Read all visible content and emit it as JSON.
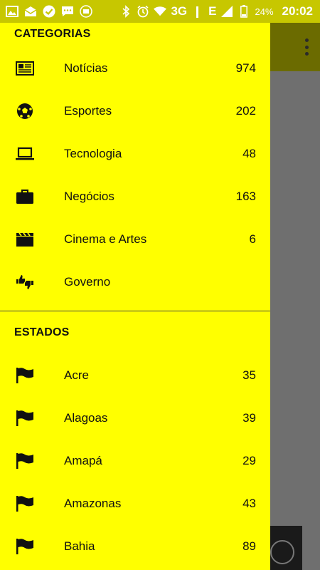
{
  "status_bar": {
    "network": "3G",
    "signal_letter": "E",
    "battery": "24%",
    "time": "20:02"
  },
  "drawer": {
    "categories_header": "CATEGORIAS",
    "categories": [
      {
        "label": "Notícias",
        "count": "974",
        "icon": "newspaper-icon"
      },
      {
        "label": "Esportes",
        "count": "202",
        "icon": "soccer-ball-icon"
      },
      {
        "label": "Tecnologia",
        "count": "48",
        "icon": "laptop-icon"
      },
      {
        "label": "Negócios",
        "count": "163",
        "icon": "briefcase-icon"
      },
      {
        "label": "Cinema e Artes",
        "count": "6",
        "icon": "clapperboard-icon"
      },
      {
        "label": "Governo",
        "count": "",
        "icon": "thumbs-up-down-icon"
      }
    ],
    "states_header": "ESTADOS",
    "states": [
      {
        "label": "Acre",
        "count": "35",
        "icon": "flag-icon"
      },
      {
        "label": "Alagoas",
        "count": "39",
        "icon": "flag-icon"
      },
      {
        "label": "Amapá",
        "count": "29",
        "icon": "flag-icon"
      },
      {
        "label": "Amazonas",
        "count": "43",
        "icon": "flag-icon"
      },
      {
        "label": "Bahia",
        "count": "89",
        "icon": "flag-icon"
      }
    ]
  },
  "colors": {
    "drawer_bg": "#ffff00",
    "status_bar_bg": "#c7c700",
    "toolbar_bg": "#6b6b00",
    "scrim": "#6f6f6f"
  }
}
